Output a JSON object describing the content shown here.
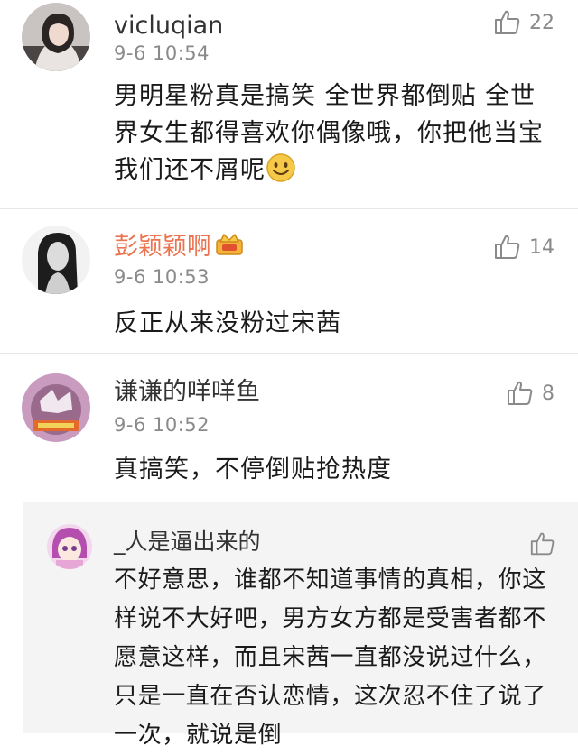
{
  "comments": [
    {
      "username": "vicluqian",
      "time": "9-6 10:54",
      "likes": "22",
      "text": "男明星粉真是搞笑 全世界都倒贴 全世界女生都得喜欢你偶像哦，你把他当宝我们还不屑呢"
    },
    {
      "username": "彭颖颖啊",
      "time": "9-6 10:53",
      "likes": "14",
      "text": "反正从来没粉过宋茜"
    },
    {
      "username": "谦谦的咩咩鱼",
      "time": "9-6 10:52",
      "likes": "8",
      "text": "真搞笑，不停倒贴抢热度"
    }
  ],
  "reply": {
    "username": "_人是逼出来的",
    "text": "不好意思，谁都不知道事情的真相，你这样说不大好吧，男方女方都是受害者都不愿意这样，而且宋茜一直都没说过什么，只是一直在否认恋情，这次忍不住了说了一次，就说是倒"
  },
  "colors": {
    "vip_name": "#eb7350",
    "meta_gray": "#8a8a8a",
    "divider": "#e6e6e6",
    "reply_bg": "#f4f4f4"
  },
  "icons": [
    "thumbs-up-icon",
    "smiley-emoji-icon",
    "vip-crown-icon"
  ]
}
